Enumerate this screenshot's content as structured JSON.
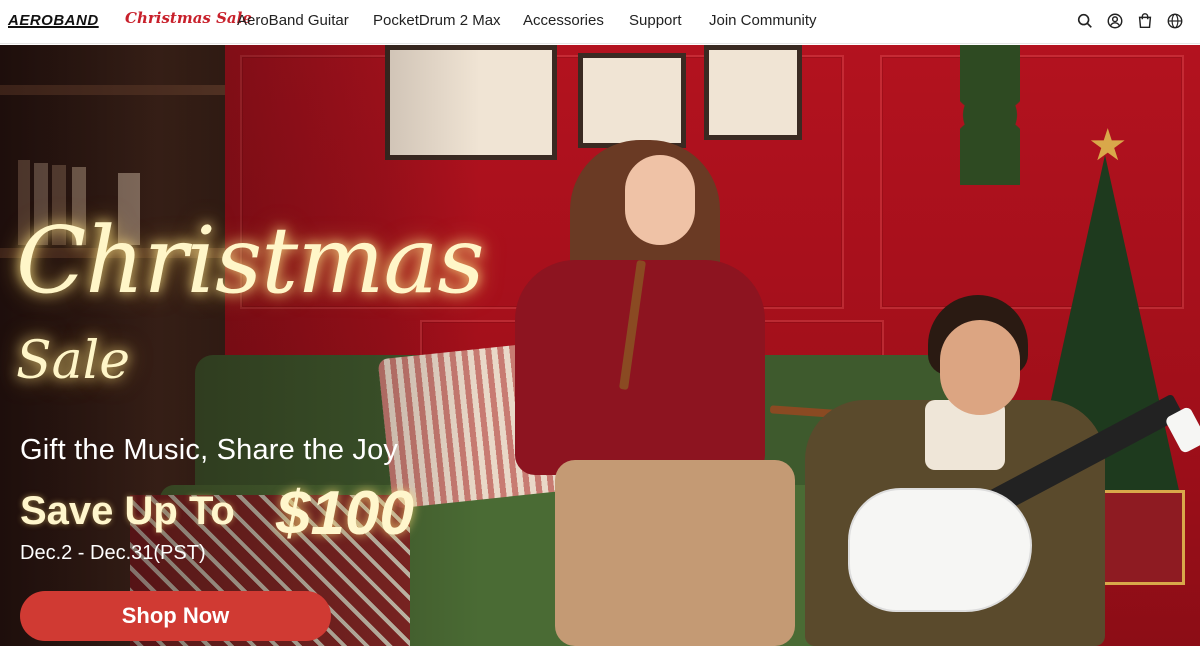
{
  "header": {
    "logo": "AEROBAND",
    "sale_link": "Christmas Sale",
    "nav": [
      "AeroBand Guitar",
      "PocketDrum 2 Max",
      "Accessories",
      "Support",
      "Join Community"
    ],
    "icons": [
      "search-icon",
      "account-icon",
      "cart-icon",
      "language-icon"
    ]
  },
  "hero": {
    "title_line1": "Christmas",
    "title_line2": "Sale",
    "subtitle": "Gift the Music, Share the Joy",
    "save_label": "Save Up To",
    "save_amount": "$100",
    "dates": "Dec.2 - Dec.31(PST)",
    "cta": "Shop Now"
  },
  "colors": {
    "accent": "#d03a33",
    "brand_red": "#c8202b",
    "headline_glow": "#fff6c8"
  }
}
